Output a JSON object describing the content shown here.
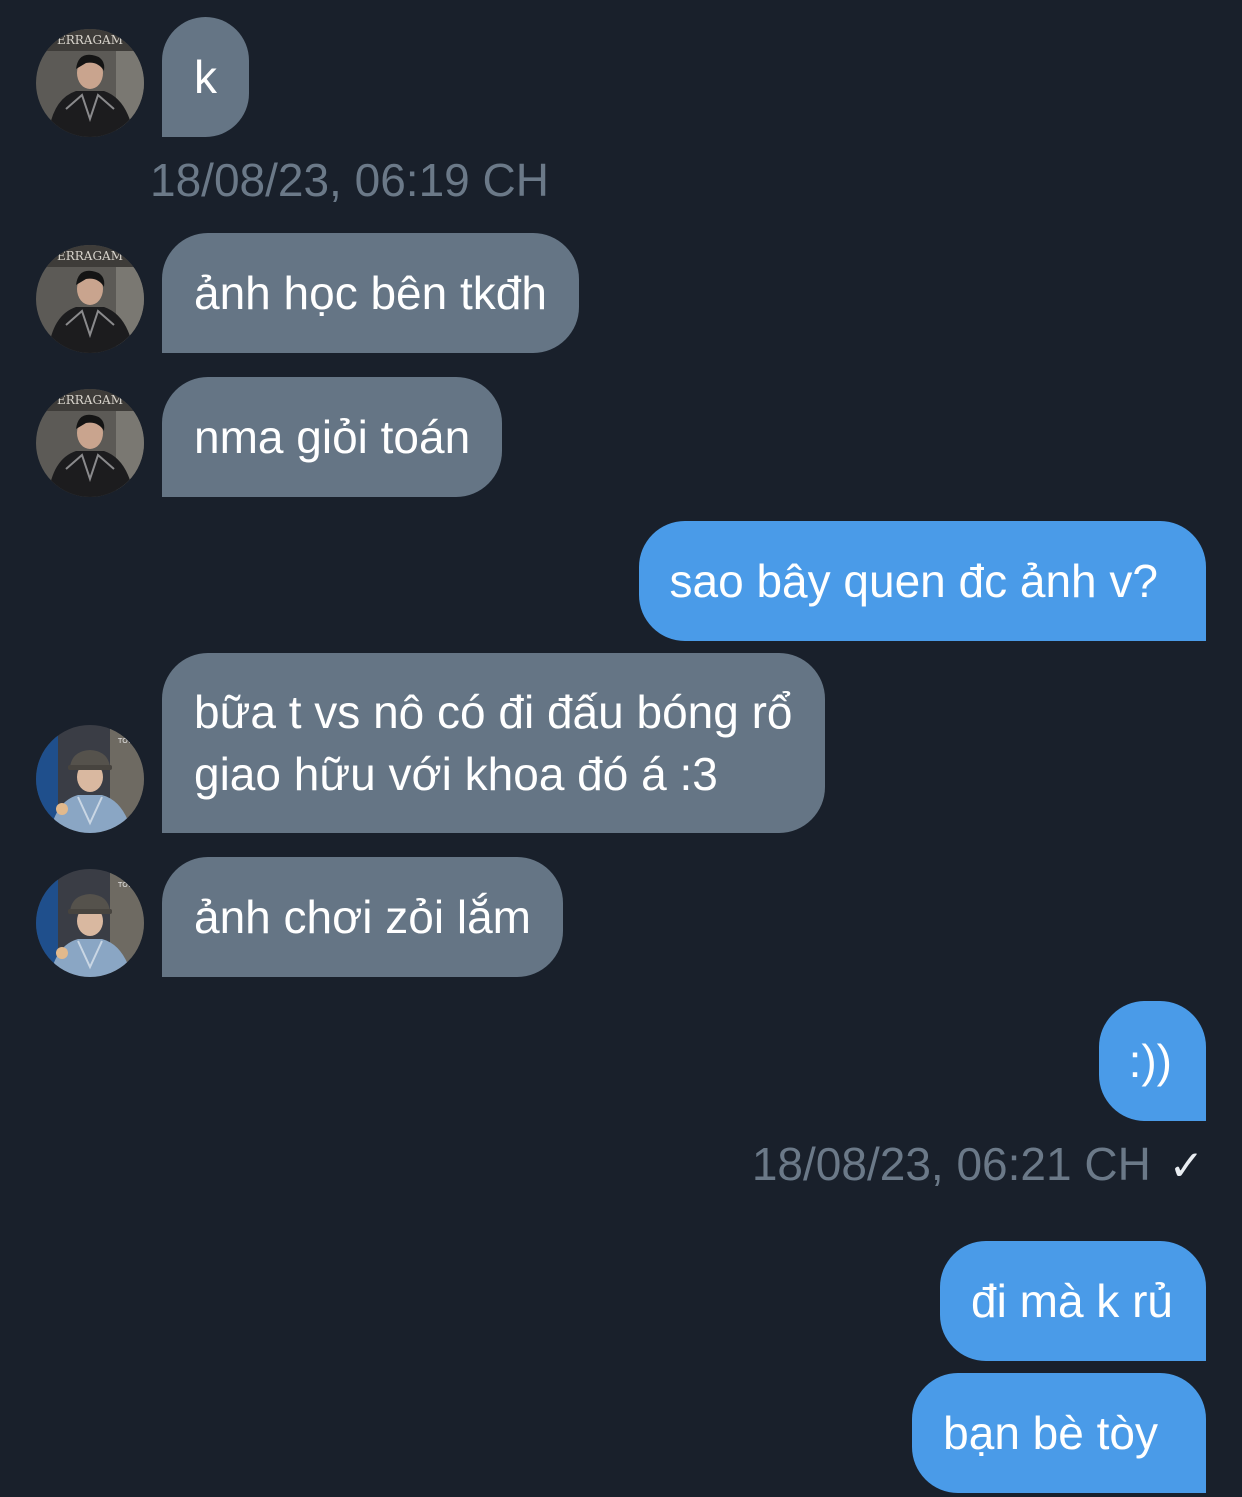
{
  "conversation": {
    "messages": [
      {
        "id": "m1",
        "direction": "incoming",
        "text": "k"
      },
      {
        "id": "m2",
        "direction": "incoming",
        "text": "ảnh học bên tkđh"
      },
      {
        "id": "m3",
        "direction": "incoming",
        "text": "nma giỏi toán"
      },
      {
        "id": "m4",
        "direction": "outgoing",
        "text": "sao bây quen đc ảnh v?"
      },
      {
        "id": "m5",
        "direction": "incoming",
        "lines": [
          "bữa t vs nô có đi đấu bóng rổ",
          "giao hữu với khoa đó á :3"
        ]
      },
      {
        "id": "m6",
        "direction": "incoming",
        "text": "ảnh chơi zỏi lắm"
      },
      {
        "id": "m7",
        "direction": "outgoing",
        "text": ":))"
      },
      {
        "id": "m8",
        "direction": "outgoing",
        "text": "đi mà k rủ"
      },
      {
        "id": "m9",
        "direction": "outgoing",
        "text": "bạn bè tòy"
      }
    ],
    "timestamps": {
      "first": "18/08/23, 06:19 CH",
      "second": "18/08/23, 06:21 CH"
    },
    "read_receipt_icon": "checkmark-icon"
  },
  "colors": {
    "background": "#19202b",
    "incoming_bubble": "#657585",
    "outgoing_bubble": "#4a9be8",
    "timestamp_text": "#6b7988"
  }
}
